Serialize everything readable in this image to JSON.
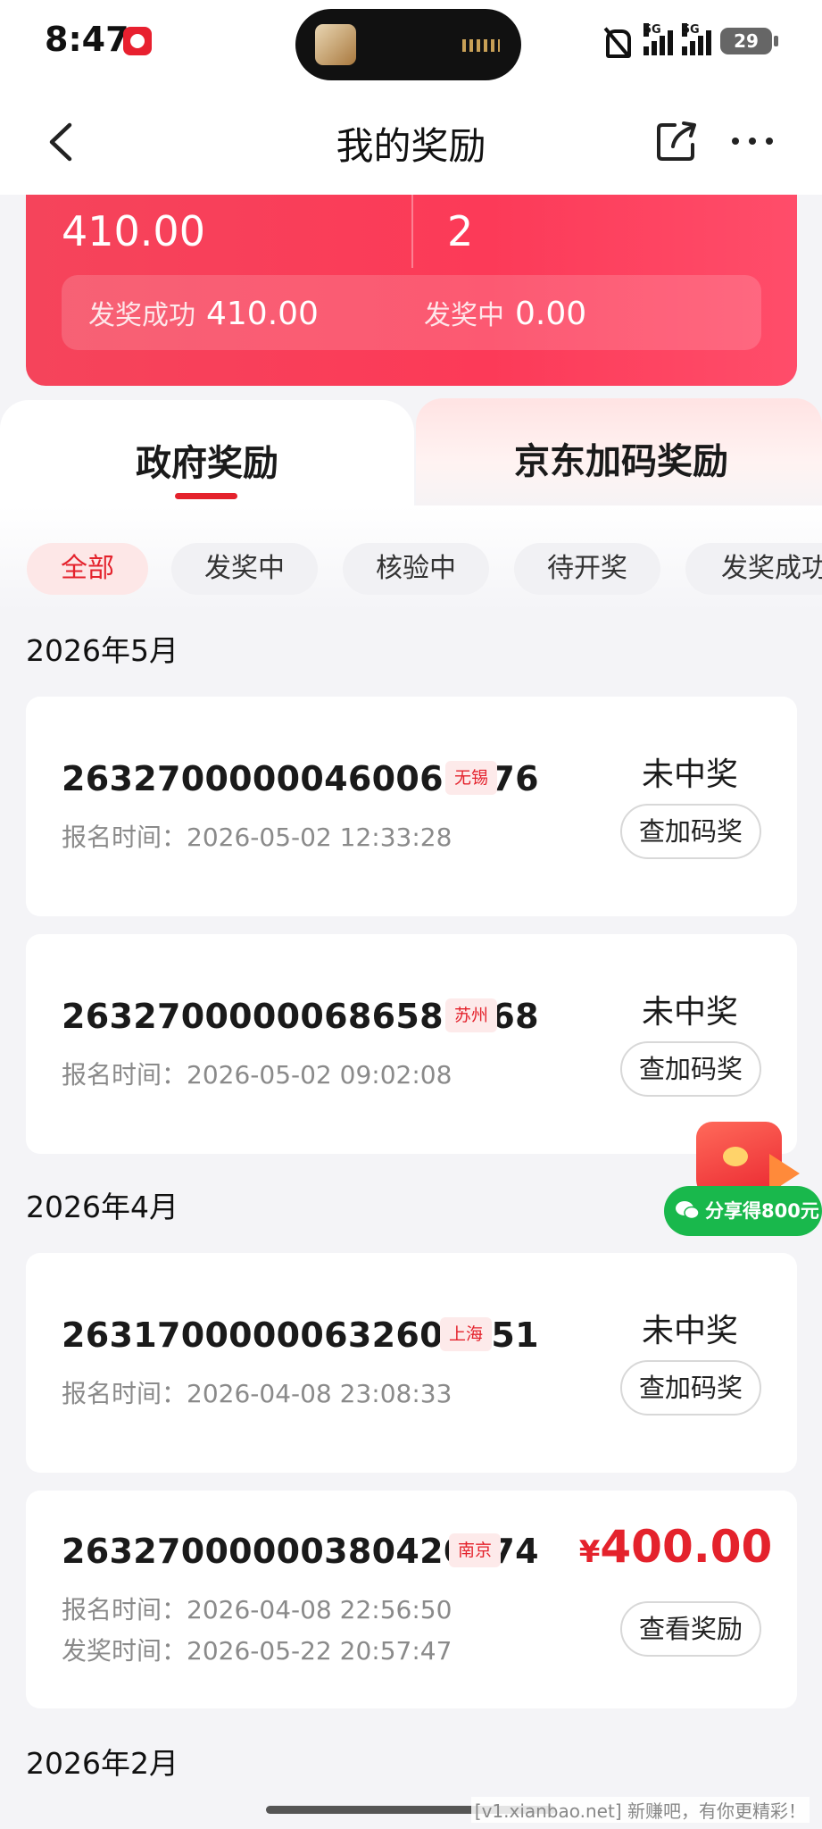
{
  "status_bar": {
    "time": "8:47",
    "signal_1": "5G",
    "signal_2": "5G",
    "battery": "29"
  },
  "nav": {
    "title": "我的奖励",
    "icons": [
      "chevron-left-icon",
      "share-icon",
      "more-icon"
    ]
  },
  "summary": {
    "total_amount": "410.00",
    "total_count": "2",
    "success_label": "发奖成功",
    "success_value": "410.00",
    "pending_label": "发奖中",
    "pending_value": "0.00"
  },
  "tabs": [
    {
      "label": "政府奖励",
      "active": true
    },
    {
      "label": "京东加码奖励",
      "active": false
    }
  ],
  "filters": [
    "全部",
    "发奖中",
    "核验中",
    "待开奖",
    "发奖成功"
  ],
  "sections": [
    {
      "month": "2026年5月",
      "records": [
        {
          "id": "26327000000460061476",
          "city": "无锡",
          "register_label": "报名时间：",
          "register_time": "2026-05-02 12:33:28",
          "result": "未中奖",
          "button": "查加码奖"
        },
        {
          "id": "26327000000686588168",
          "city": "苏州",
          "register_label": "报名时间：",
          "register_time": "2026-05-02 09:02:08",
          "result": "未中奖",
          "button": "查加码奖"
        }
      ]
    },
    {
      "month": "2026年4月",
      "records": [
        {
          "id": "26317000000632609851",
          "city": "上海",
          "register_label": "报名时间：",
          "register_time": "2026-04-08 23:08:33",
          "result": "未中奖",
          "button": "查加码奖"
        },
        {
          "id": "26327000000380420474",
          "city": "南京",
          "register_label": "报名时间：",
          "register_time": "2026-04-08 22:56:50",
          "award_label": "发奖时间：",
          "award_time": "2026-05-22 20:57:47",
          "currency": "¥",
          "amount": "400.00",
          "button": "查看奖励"
        }
      ]
    },
    {
      "month": "2026年2月",
      "records": []
    }
  ],
  "promo": {
    "label": "分享得800元"
  },
  "watermark": "[v1.xianbao.net] 新赚吧，有你更精彩！",
  "colors": {
    "accent": "#e4222c",
    "promo_green": "#19b84c"
  }
}
